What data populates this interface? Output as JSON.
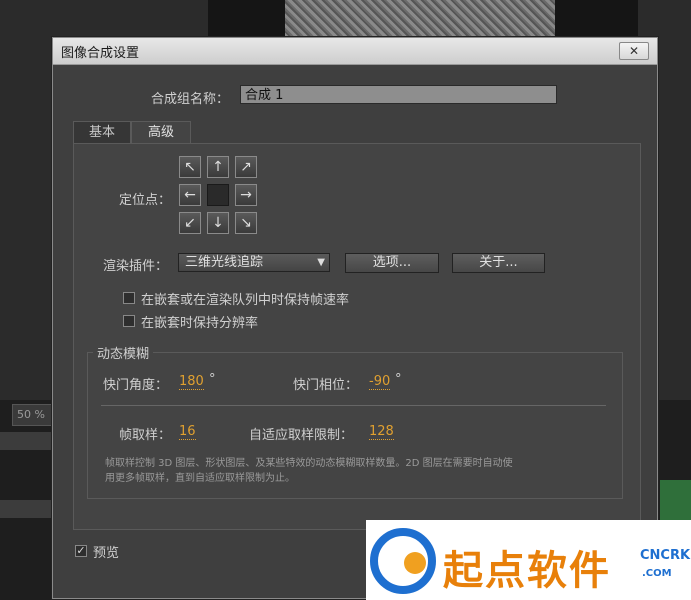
{
  "background": {
    "zoom_label": "50 %"
  },
  "dialog": {
    "title": "图像合成设置",
    "close_label": "✕",
    "comp_name_label": "合成组名称：",
    "comp_name_value": "合成 1",
    "tabs": [
      {
        "label": "基本"
      },
      {
        "label": "高级"
      }
    ],
    "active_tab": "高级",
    "anchor_label": "定位点：",
    "anchor_arrows": [
      "↖",
      "↑",
      "↗",
      "←",
      "",
      "→",
      "↙",
      "↓",
      "↘"
    ],
    "renderer_label": "渲染插件：",
    "renderer_value": "三维光线追踪",
    "options_button": "选项...",
    "about_button": "关于...",
    "checkbox_frame_rate": "在嵌套或在渲染队列中时保持帧速率",
    "checkbox_resolution": "在嵌套时保持分辨率",
    "motion_blur": {
      "group_label": "动态模糊",
      "shutter_angle_label": "快门角度：",
      "shutter_angle_value": "180",
      "shutter_angle_unit": "°",
      "shutter_phase_label": "快门相位：",
      "shutter_phase_value": "-90",
      "shutter_phase_unit": "°",
      "samples_label": "帧取样：",
      "samples_value": "16",
      "adaptive_label": "自适应取样限制：",
      "adaptive_value": "128",
      "description_line1": "帧取样控制 3D 图层、形状图层、及某些特效的动态模糊取样数量。2D 图层在需要时自动使",
      "description_line2": "用更多帧取样，直到自适应取样限制为止。"
    },
    "preview_label": "预览",
    "preview_check": "✓"
  },
  "watermark": {
    "brand": "起点软件",
    "cn": "CNCRK",
    "com": ".COM"
  },
  "colors": {
    "accent_value": "#e0a030",
    "logo_orange": "#e8800a",
    "logo_blue": "#1e6fd0"
  }
}
